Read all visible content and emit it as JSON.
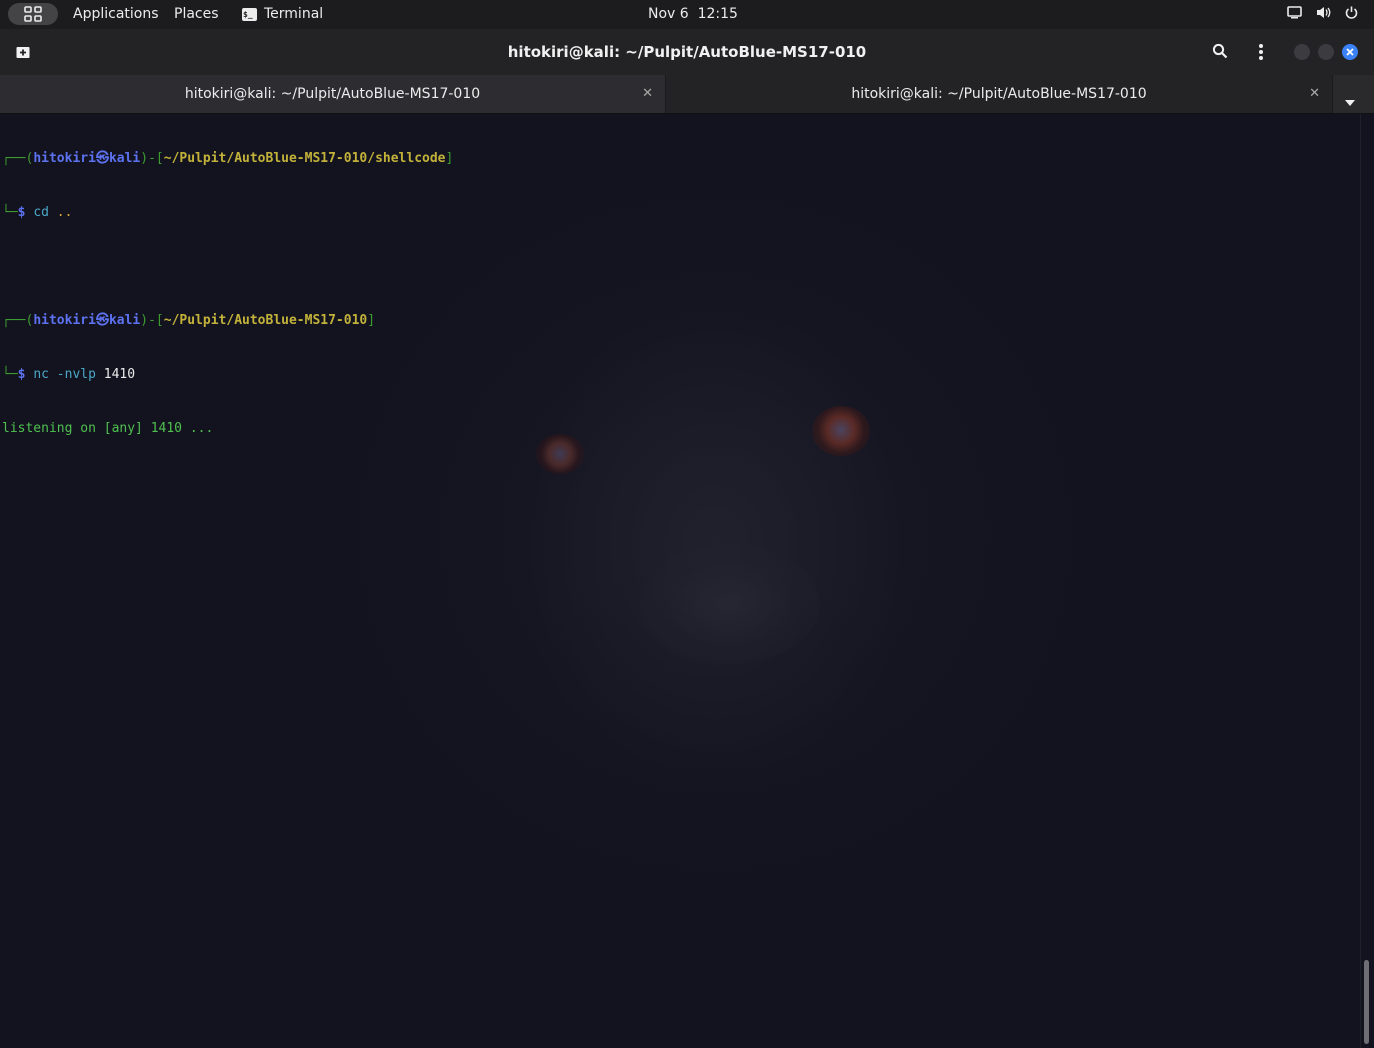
{
  "topbar": {
    "activities_icon": "grid-icon",
    "applications_label": "Applications",
    "places_label": "Places",
    "terminal_label": "Terminal",
    "clock": "Nov 6  12:15",
    "tray_icons": [
      "screen-icon",
      "volume-icon",
      "power-icon"
    ]
  },
  "window": {
    "title": "hitokiri@kali: ~/Pulpit/AutoBlue-MS17-010",
    "new_tab_icon": "new-tab-icon",
    "search_icon": "search-icon",
    "menu_icon": "kebab-menu-icon",
    "close_color": "#3b82f6"
  },
  "tabs": [
    {
      "label": "hitokiri@kali: ~/Pulpit/AutoBlue-MS17-010",
      "active": true
    },
    {
      "label": "hitokiri@kali: ~/Pulpit/AutoBlue-MS17-010",
      "active": false
    }
  ],
  "terminal": {
    "prompt1": {
      "open": "┌──(",
      "user": "hitokiri",
      "at": "㉿",
      "host": "kali",
      "mid": ")-[",
      "path": "~/Pulpit/AutoBlue-MS17-010/shellcode",
      "close": "]",
      "dollar_prefix": "└─",
      "dollar": "$",
      "cmd": "cd",
      "arg": ".."
    },
    "prompt2": {
      "open": "┌──(",
      "user": "hitokiri",
      "at": "㉿",
      "host": "kali",
      "mid": ")-[",
      "path": "~/Pulpit/AutoBlue-MS17-010",
      "close": "]",
      "dollar_prefix": "└─",
      "dollar": "$",
      "cmd": "nc",
      "arg": "-nvlp",
      "num": "1410"
    },
    "output": "listening on [any] 1410 ..."
  }
}
